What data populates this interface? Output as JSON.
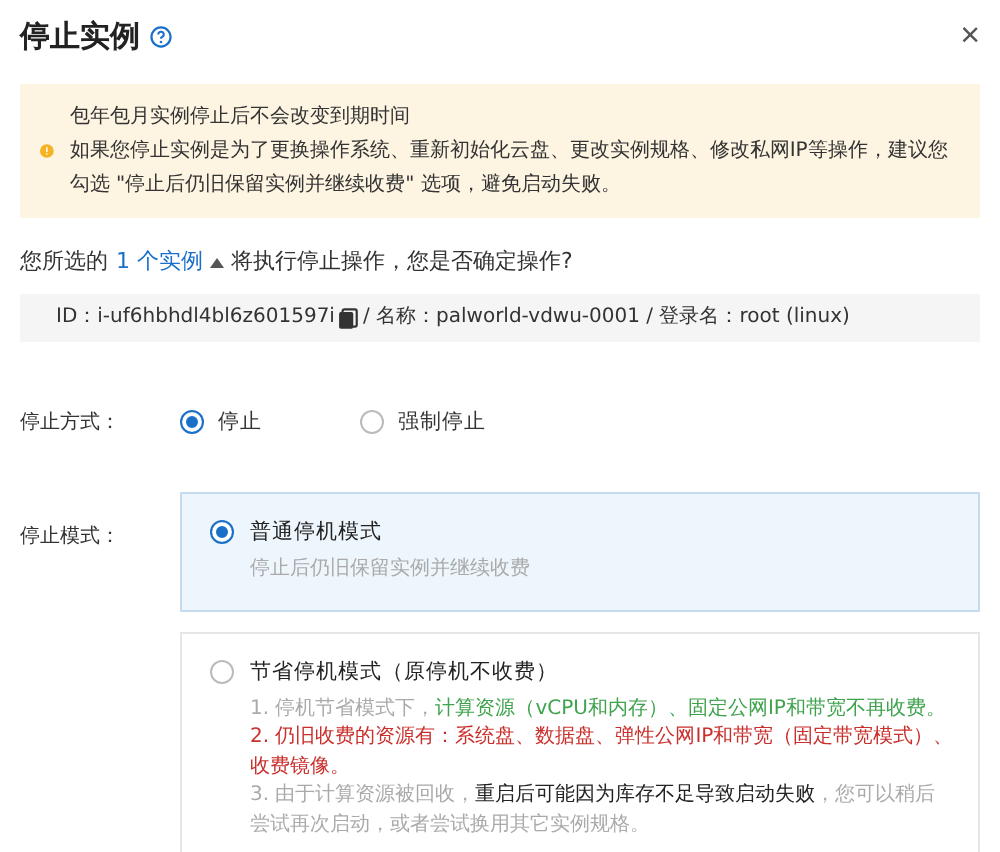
{
  "dialog": {
    "title": "停止实例",
    "close": "×"
  },
  "alert": {
    "lines": [
      "包年包月实例停止后不会改变到期时间",
      "如果您停止实例是为了更换操作系统、重新初始化云盘、更改实例规格、修改私网IP等操作，建议您勾选 \"停止后仍旧保留实例并继续收费\" 选项，避免启动失败。"
    ]
  },
  "question": {
    "before": "您所选的",
    "link": "1 个实例",
    "after": "将执行停止操作，您是否确定操作?",
    "expanded": true
  },
  "instance": {
    "id": "ID：i-uf6hbhdl4bl6z601597i",
    "rest": "/ 名称：palworld-vdwu-0001 / 登录名：root (linux)"
  },
  "stop_method": {
    "label": "停止方式：",
    "options": [
      {
        "label": "停止",
        "selected": true
      },
      {
        "label": "强制停止",
        "selected": false
      }
    ]
  },
  "stop_mode": {
    "label": "停止模式：",
    "options": [
      {
        "title": "普通停机模式",
        "selected": true,
        "notes": [
          [
            {
              "text": "停止后仍旧保留实例并继续收费",
              "color": "#aaaaaa"
            }
          ]
        ]
      },
      {
        "title": "节省停机模式（原停机不收费）",
        "selected": false,
        "notes": [
          [
            {
              "text": "1. 停机节省模式下，",
              "color": "#aaaaaa"
            },
            {
              "text": "计算资源（vCPU和内存）、固定公网IP和带宽不再收费。",
              "color": "#3fa34d"
            }
          ],
          [
            {
              "text": "2. 仍旧收费的资源有：系统盘、数据盘、弹性公网IP和带宽（固定带宽模式）、收费镜像。",
              "color": "#c9302c"
            }
          ],
          [
            {
              "text": "3. 由于计算资源被回收，",
              "color": "#aaaaaa"
            },
            {
              "text": "重启后可能因为库存不足导致启动失败",
              "color": "#222222"
            },
            {
              "text": "，您可以稍后尝试再次启动，或者尝试换用其它实例规格。",
              "color": "#aaaaaa"
            }
          ]
        ]
      }
    ]
  }
}
